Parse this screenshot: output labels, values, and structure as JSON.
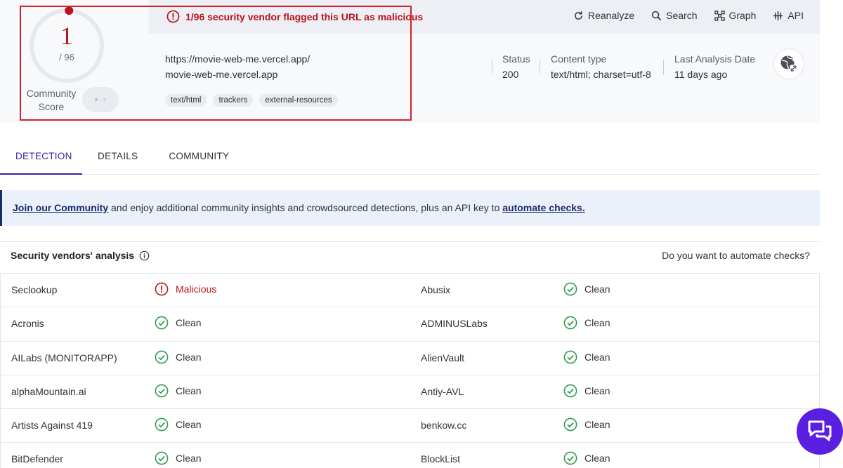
{
  "score": {
    "flagged": "1",
    "total": "/ 96",
    "community_label_line1": "Community",
    "community_label_line2": "Score",
    "detection_fraction": 0.0104
  },
  "alert": {
    "text": "1/96 security vendor flagged this URL as malicious"
  },
  "toolbar": {
    "reanalyze": "Reanalyze",
    "search": "Search",
    "graph": "Graph",
    "api": "API"
  },
  "target": {
    "url": "https://movie-web-me.vercel.app/",
    "domain": "movie-web-me.vercel.app",
    "tags": [
      "text/html",
      "trackers",
      "external-resources"
    ]
  },
  "meta": {
    "status_label": "Status",
    "status_value": "200",
    "content_type_label": "Content type",
    "content_type_value": "text/html; charset=utf-8",
    "last_analysis_label": "Last Analysis Date",
    "last_analysis_value": "11 days ago"
  },
  "tabs": [
    {
      "label": "DETECTION",
      "active": true
    },
    {
      "label": "DETAILS",
      "active": false
    },
    {
      "label": "COMMUNITY",
      "active": false
    }
  ],
  "banner": {
    "link1": "Join our Community",
    "middle": " and enjoy additional community insights and crowdsourced detections, plus an API key to ",
    "link2": "automate checks."
  },
  "vendors": {
    "title": "Security vendors' analysis",
    "cta": "Do you want to automate checks?",
    "rows": [
      {
        "left": {
          "name": "Seclookup",
          "result": "Malicious"
        },
        "right": {
          "name": "Abusix",
          "result": "Clean"
        }
      },
      {
        "left": {
          "name": "Acronis",
          "result": "Clean"
        },
        "right": {
          "name": "ADMINUSLabs",
          "result": "Clean"
        }
      },
      {
        "left": {
          "name": "AILabs (MONITORAPP)",
          "result": "Clean"
        },
        "right": {
          "name": "AlienVault",
          "result": "Clean"
        }
      },
      {
        "left": {
          "name": "alphaMountain.ai",
          "result": "Clean"
        },
        "right": {
          "name": "Antiy-AVL",
          "result": "Clean"
        }
      },
      {
        "left": {
          "name": "Artists Against 419",
          "result": "Clean"
        },
        "right": {
          "name": "benkow.cc",
          "result": "Clean"
        }
      },
      {
        "left": {
          "name": "BitDefender",
          "result": "Clean"
        },
        "right": {
          "name": "BlockList",
          "result": "Clean"
        }
      }
    ]
  },
  "colors": {
    "malicious": "#b8161c",
    "clean": "#2e9d4b",
    "accent": "#3a1fa3",
    "chat": "#5a1fe0"
  }
}
